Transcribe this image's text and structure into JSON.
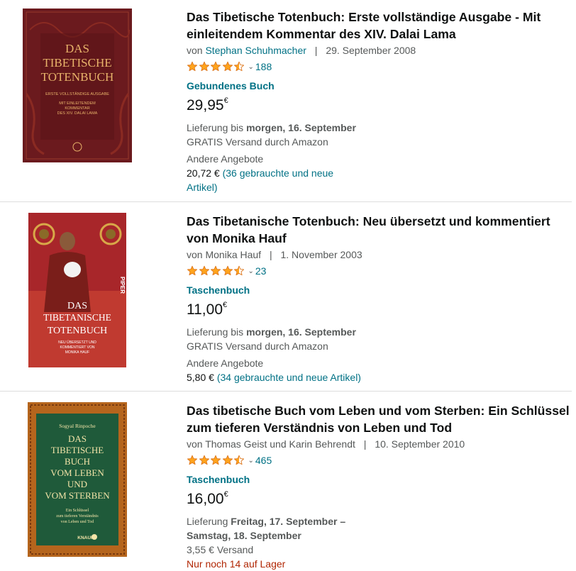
{
  "results": [
    {
      "title": "Das Tibetische Totenbuch: Erste vollständige Ausgabe - Mit einleitendem Kommentar des XIV. Dalai Lama",
      "by_prefix": "von",
      "author": "Stephan Schuhmacher",
      "separator": "|",
      "date": "29. September 2008",
      "rating": 4.5,
      "rating_count": "188",
      "format": "Gebundenes Buch",
      "price_main": "29,95",
      "price_currency": "€",
      "delivery_prefix": "Lieferung bis",
      "delivery_bold": "morgen, 16. September",
      "shipping": "GRATIS Versand durch Amazon",
      "offers_label": "Andere Angebote",
      "offers_price": "20,72 €",
      "offers_link": "(36 gebrauchte und neue Artikel)",
      "cover": {
        "lines": [
          "DAS",
          "TIBETISCHE",
          "TOTENBUCH"
        ],
        "subtitle_lines": [
          "ERSTE VOLLSTÄNDIGE AUSGABE",
          "MIT EINLEITENDEM",
          "KOMMENTAR",
          "DES XIV. DALAI LAMA"
        ],
        "bg": "#6b1a1e",
        "text_color": "#e8b36a"
      }
    },
    {
      "title": "Das Tibetanische Totenbuch: Neu übersetzt und kommentiert von Monika Hauf",
      "by_prefix": "von",
      "author": "Monika Hauf",
      "separator": "|",
      "date": "1. November 2003",
      "rating": 4.5,
      "rating_count": "23",
      "format": "Taschenbuch",
      "price_main": "11,00",
      "price_currency": "€",
      "delivery_prefix": "Lieferung bis",
      "delivery_bold": "morgen, 16. September",
      "shipping": "GRATIS Versand durch Amazon",
      "offers_label": "Andere Angebote",
      "offers_price": "5,80 €",
      "offers_link": "(34 gebrauchte und neue Artikel)",
      "cover": {
        "lines": [
          "DAS",
          "TIBETANISCHE",
          "TOTENBUCH"
        ],
        "subtitle_lines": [
          "NEU ÜBERSETZT UND",
          "KOMMENTIERT VON",
          "MONIKA HAUF"
        ],
        "publisher": "PIPER",
        "bg": "#b8312c",
        "text_color": "#ffffff"
      }
    },
    {
      "title": "Das tibetische Buch vom Leben und vom Sterben: Ein Schlüssel zum tieferen Verständnis von Leben und Tod",
      "by_prefix": "von",
      "author": "Thomas Geist und Karin Behrendt",
      "separator": "|",
      "date": "10. September 2010",
      "rating": 4.5,
      "rating_count": "465",
      "format": "Taschenbuch",
      "price_main": "16,00",
      "price_currency": "€",
      "delivery_prefix": "Lieferung",
      "delivery_bold": "Freitag, 17. September –",
      "delivery_bold2": "Samstag, 18. September",
      "shipping": "3,55 € Versand",
      "stock": "Nur noch 14 auf Lager",
      "cover": {
        "author_line": "Sogyal Rinpoche",
        "lines": [
          "DAS",
          "TIBETISCHE",
          "BUCH",
          "VOM LEBEN",
          "UND",
          "VOM STERBEN"
        ],
        "subtitle_lines": [
          "Ein Schlüssel",
          "zum tieferen Verständnis",
          "von Leben und Tod"
        ],
        "publisher": "KNAUR",
        "bg": "#1f5a3a",
        "border_color": "#b5651d",
        "text_color": "#f3e4a8"
      }
    }
  ],
  "colors": {
    "link": "#007185",
    "text": "#0f1111",
    "muted": "#565959",
    "star": "#ffa41c",
    "stock": "#b12704"
  }
}
